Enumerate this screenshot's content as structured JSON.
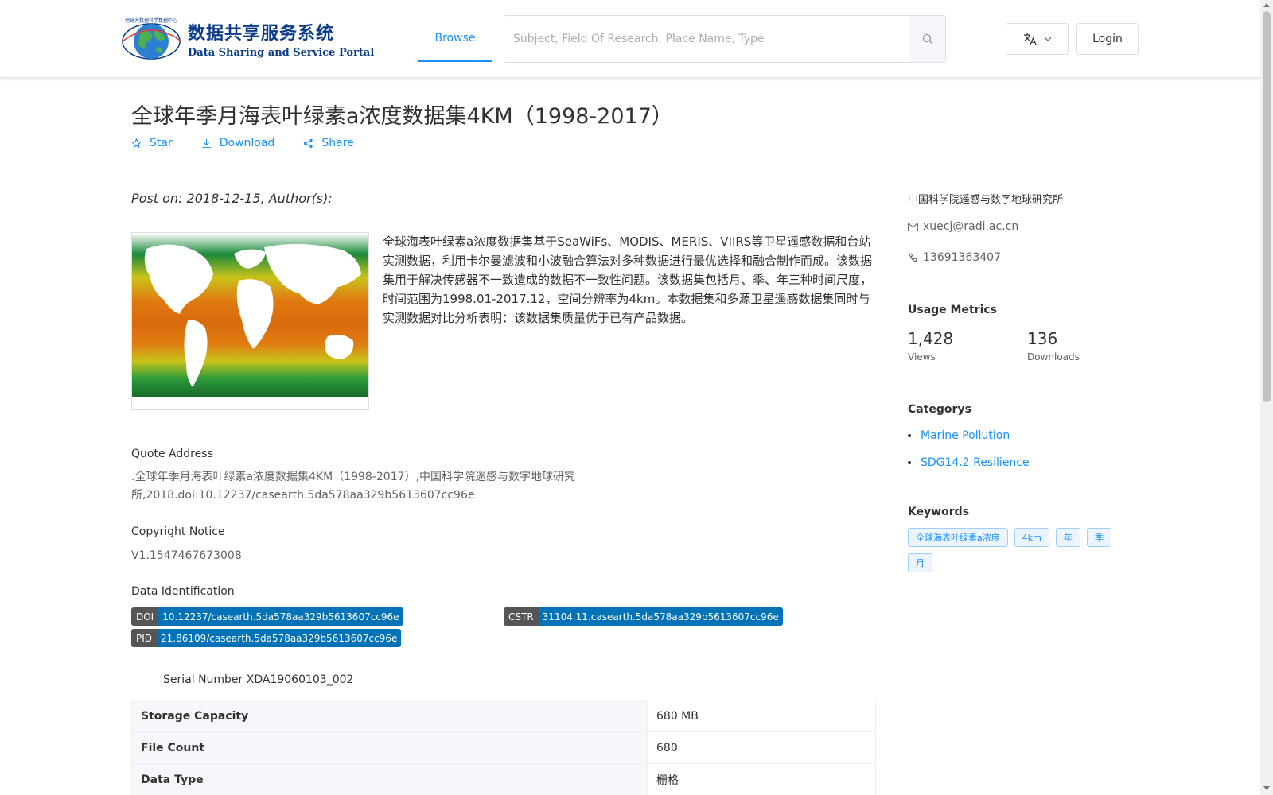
{
  "header": {
    "logo_cn": "数据共享服务系统",
    "logo_en": "Data Sharing and Service Portal",
    "nav_browse": "Browse",
    "search_placeholder": "Subject, Field Of Research, Place Name, Type",
    "login": "Login"
  },
  "dataset": {
    "title": "全球年季月海表叶绿素a浓度数据集4KM（1998-2017）",
    "actions": {
      "star": "Star",
      "download": "Download",
      "share": "Share"
    },
    "post_on": "Post on: 2018-12-15, Author(s):",
    "description": "全球海表叶绿素a浓度数据集基于SeaWiFs、MODIS、MERIS、VIIRS等卫星遥感数据和台站实测数据，利用卡尔曼滤波和小波融合算法对多种数据进行最优选择和融合制作而成。该数据集用于解决传感器不一致造成的数据不一致性问题。该数据集包括月、季、年三种时间尺度，时间范围为1998.01-2017.12，空间分辨率为4km。本数据集和多源卫星遥感数据集同时与实测数据对比分析表明：该数据集质量优于已有产品数据。",
    "quote_label": "Quote Address",
    "quote_text": ".全球年季月海表叶绿素a浓度数据集4KM（1998-2017）,中国科学院遥感与数字地球研究所,2018.doi:10.12237/casearth.5da578aa329b5613607cc96e",
    "copyright_label": "Copyright Notice",
    "copyright_text": "V1.1547467673008",
    "ident_label": "Data Identification",
    "doi_key": "DOI",
    "doi_val": "10.12237/casearth.5da578aa329b5613607cc96e",
    "cstr_key": "CSTR",
    "cstr_val": "31104.11.casearth.5da578aa329b5613607cc96e",
    "pid_key": "PID",
    "pid_val": "21.86109/casearth.5da578aa329b5613607cc96e",
    "serial": "Serial Number XDA19060103_002",
    "table": [
      {
        "label": "Storage Capacity",
        "value": "680 MB"
      },
      {
        "label": "File Count",
        "value": "680"
      },
      {
        "label": "Data Type",
        "value": "栅格"
      }
    ]
  },
  "sidebar": {
    "org": "中国科学院遥感与数字地球研究所",
    "email": "xuecj@radi.ac.cn",
    "phone": "13691363407",
    "metrics_title": "Usage Metrics",
    "views_num": "1,428",
    "views_lbl": "Views",
    "downloads_num": "136",
    "downloads_lbl": "Downloads",
    "categories_title": "Categorys",
    "categories": [
      "Marine Pollution",
      "SDG14.2 Resilience"
    ],
    "keywords_title": "Keywords",
    "keywords": [
      "全球海表叶绿素a浓度",
      "4km",
      "年",
      "季",
      "月"
    ]
  },
  "colors": {
    "accent": "#1890ff",
    "badge_key": "#555555",
    "badge_val": "#0072b8"
  }
}
